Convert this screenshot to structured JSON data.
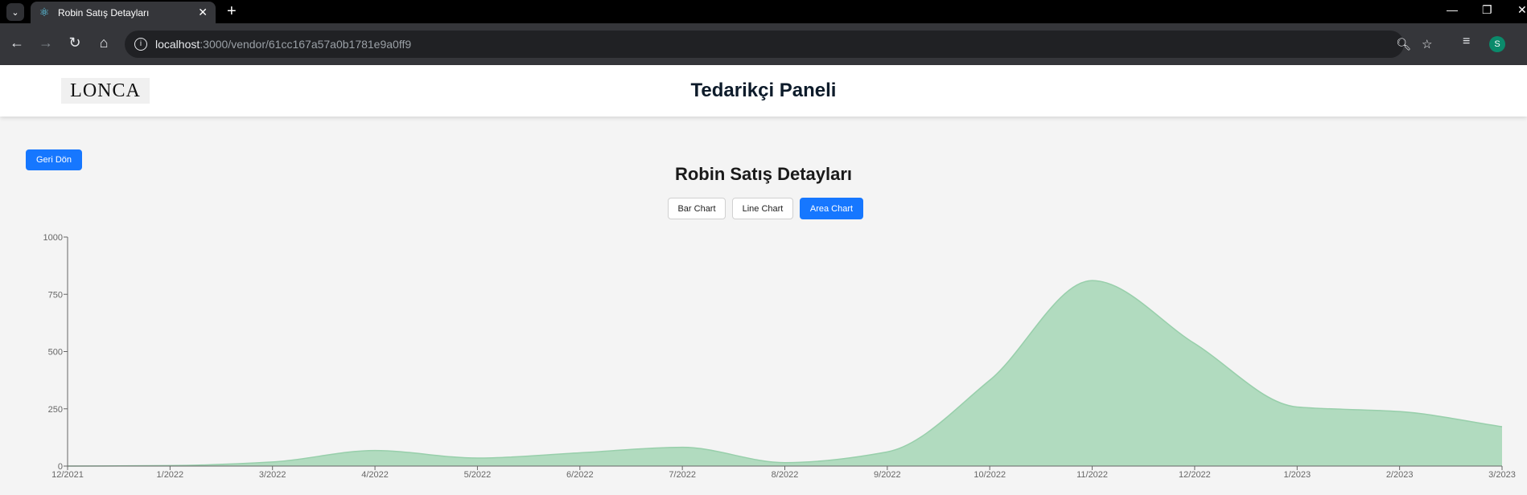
{
  "browser": {
    "tab_title": "Robin Satış Detayları",
    "url_host": "localhost",
    "url_path": ":3000/vendor/61cc167a57a0b1781e9a0ff9",
    "profile_initial": "S"
  },
  "header": {
    "logo": "LONCA",
    "title": "Tedarikçi Paneli"
  },
  "page": {
    "back_label": "Geri Dön",
    "title": "Robin Satış Detayları",
    "chart_buttons": [
      "Bar Chart",
      "Line Chart",
      "Area Chart"
    ],
    "active_chart": "Area Chart"
  },
  "colors": {
    "accent": "#1677ff",
    "area_fill": "#b1dbbf",
    "area_stroke": "#98cfab"
  },
  "chart_data": {
    "type": "area",
    "categories": [
      "12/2021",
      "1/2022",
      "3/2022",
      "4/2022",
      "5/2022",
      "6/2022",
      "7/2022",
      "8/2022",
      "9/2022",
      "10/2022",
      "11/2022",
      "12/2022",
      "1/2023",
      "2/2023",
      "3/2023"
    ],
    "values": [
      0,
      2,
      18,
      68,
      35,
      58,
      82,
      15,
      62,
      375,
      810,
      535,
      258,
      238,
      172
    ],
    "ylim": [
      0,
      1000
    ],
    "yticks": [
      0,
      250,
      500,
      750,
      1000
    ],
    "grid": false
  }
}
